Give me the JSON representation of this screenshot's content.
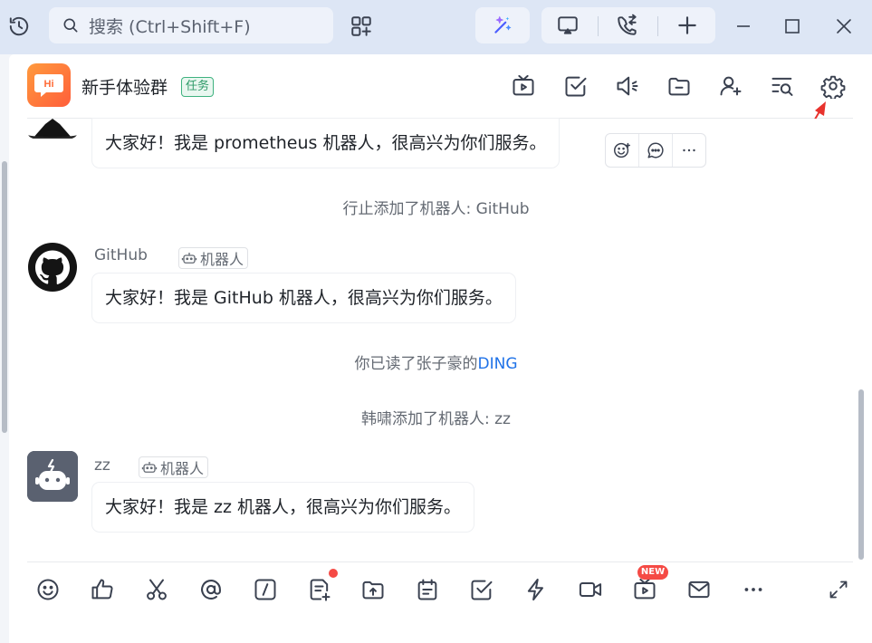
{
  "colors": {
    "accent": "#1f72e8",
    "titlebar": "#dde6f5",
    "annotation_arrow": "#e8322d",
    "task_tag": "#2e9a68",
    "notification": "#f54a45"
  },
  "topbar": {
    "history_icon": "history-icon",
    "search_placeholder": "搜索 (Ctrl+Shift+F)",
    "icons": [
      "search-icon",
      "apps-add-icon",
      "ai-sparkle-icon",
      "screen-share-icon",
      "phone-transfer-icon",
      "plus-icon",
      "minimize-icon",
      "maximize-icon",
      "close-icon"
    ]
  },
  "chat_header": {
    "group_name": "新手体验群",
    "group_avatar_text": "Hi",
    "tag": "任务",
    "icons": [
      "live-tv-icon",
      "task-check-icon",
      "announcement-icon",
      "folder-icon",
      "add-member-icon",
      "search-history-icon",
      "settings-icon"
    ]
  },
  "messages": [
    {
      "type": "message",
      "text": "大家好！我是 prometheus 机器人，很高兴为你们服务。"
    },
    {
      "type": "system",
      "text": "行止添加了机器人: GitHub"
    },
    {
      "type": "message",
      "sender": "GitHub",
      "tag": "机器人",
      "text": "大家好！我是 GitHub 机器人，很高兴为你们服务。"
    },
    {
      "type": "system",
      "text_prefix": "你已读了张子豪的",
      "text_link": "DING"
    },
    {
      "type": "system",
      "text": "韩啸添加了机器人: zz"
    },
    {
      "type": "message",
      "sender": "zz",
      "tag": "机器人",
      "text": "大家好！我是 zz 机器人，很高兴为你们服务。"
    }
  ],
  "hover_actions": [
    "emoji-reply-icon",
    "reply-thread-icon",
    "more-icon"
  ],
  "toolbar": {
    "icons": [
      "emoji-icon",
      "thumbs-up-icon",
      "scissors-icon",
      "at-mention-icon",
      "slash-command-icon",
      "doc-add-icon",
      "file-upload-icon",
      "calendar-icon",
      "todo-check-icon",
      "lightning-icon",
      "video-call-icon",
      "live-icon",
      "mail-icon",
      "more-icon",
      "expand-icon"
    ],
    "new_badge": "NEW"
  }
}
